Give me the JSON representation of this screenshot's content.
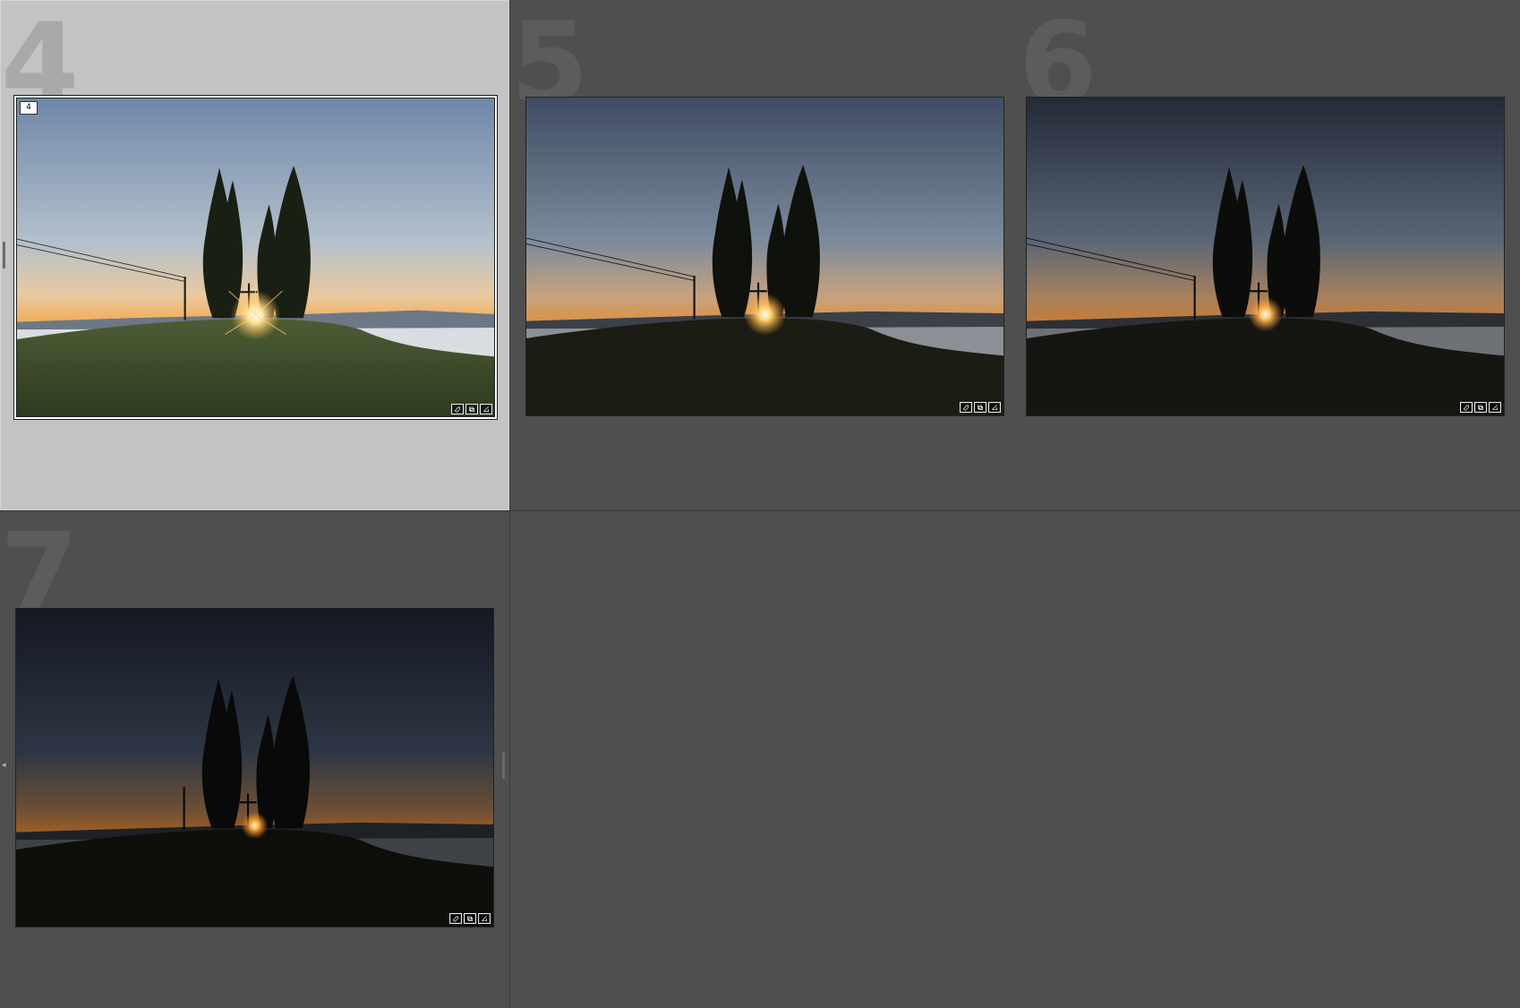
{
  "grid": {
    "cells": [
      {
        "index": "4",
        "badge": "4",
        "selected": true,
        "exposure": "bright"
      },
      {
        "index": "5",
        "badge": "",
        "selected": false,
        "exposure": "medium"
      },
      {
        "index": "6",
        "badge": "",
        "selected": false,
        "exposure": "dark"
      },
      {
        "index": "7",
        "badge": "",
        "selected": false,
        "exposure": "darkest"
      }
    ]
  },
  "icons": {
    "badge_icon_1": "tag-icon",
    "badge_icon_2": "copy-icon",
    "badge_icon_3": "edit-adjust-icon"
  },
  "colors": {
    "background": "#4e4e4e",
    "selected_cell": "#c3c3c3"
  }
}
